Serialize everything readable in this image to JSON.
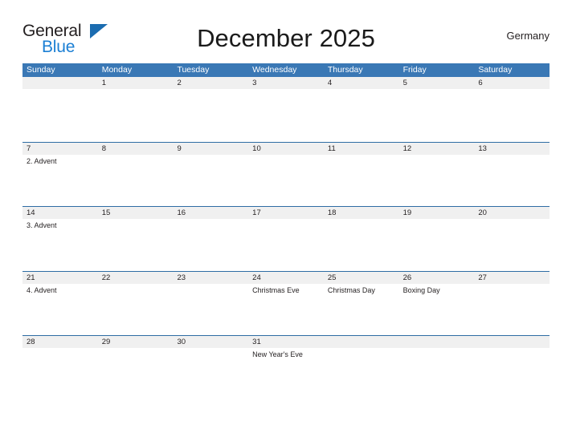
{
  "brand": {
    "name_part1": "General",
    "name_part2": "Blue",
    "flag_icon": "flag-triangle-icon",
    "color_dark": "#231f20",
    "color_blue": "#1b7fd4"
  },
  "header": {
    "title": "December 2025",
    "region": "Germany"
  },
  "theme": {
    "header_blue": "#3a78b5",
    "rule_blue": "#2e6da4",
    "date_band_gray": "#f0f0f0",
    "text": "#231f20"
  },
  "calendar": {
    "weekdays": [
      "Sunday",
      "Monday",
      "Tuesday",
      "Wednesday",
      "Thursday",
      "Friday",
      "Saturday"
    ],
    "weeks": [
      [
        {
          "date": "",
          "events": []
        },
        {
          "date": "1",
          "events": []
        },
        {
          "date": "2",
          "events": []
        },
        {
          "date": "3",
          "events": []
        },
        {
          "date": "4",
          "events": []
        },
        {
          "date": "5",
          "events": []
        },
        {
          "date": "6",
          "events": []
        }
      ],
      [
        {
          "date": "7",
          "events": [
            "2. Advent"
          ]
        },
        {
          "date": "8",
          "events": []
        },
        {
          "date": "9",
          "events": []
        },
        {
          "date": "10",
          "events": []
        },
        {
          "date": "11",
          "events": []
        },
        {
          "date": "12",
          "events": []
        },
        {
          "date": "13",
          "events": []
        }
      ],
      [
        {
          "date": "14",
          "events": [
            "3. Advent"
          ]
        },
        {
          "date": "15",
          "events": []
        },
        {
          "date": "16",
          "events": []
        },
        {
          "date": "17",
          "events": []
        },
        {
          "date": "18",
          "events": []
        },
        {
          "date": "19",
          "events": []
        },
        {
          "date": "20",
          "events": []
        }
      ],
      [
        {
          "date": "21",
          "events": [
            "4. Advent"
          ]
        },
        {
          "date": "22",
          "events": []
        },
        {
          "date": "23",
          "events": []
        },
        {
          "date": "24",
          "events": [
            "Christmas Eve"
          ]
        },
        {
          "date": "25",
          "events": [
            "Christmas Day"
          ]
        },
        {
          "date": "26",
          "events": [
            "Boxing Day"
          ]
        },
        {
          "date": "27",
          "events": []
        }
      ],
      [
        {
          "date": "28",
          "events": []
        },
        {
          "date": "29",
          "events": []
        },
        {
          "date": "30",
          "events": []
        },
        {
          "date": "31",
          "events": [
            "New Year's Eve"
          ]
        },
        {
          "date": "",
          "events": []
        },
        {
          "date": "",
          "events": []
        },
        {
          "date": "",
          "events": []
        }
      ]
    ]
  }
}
